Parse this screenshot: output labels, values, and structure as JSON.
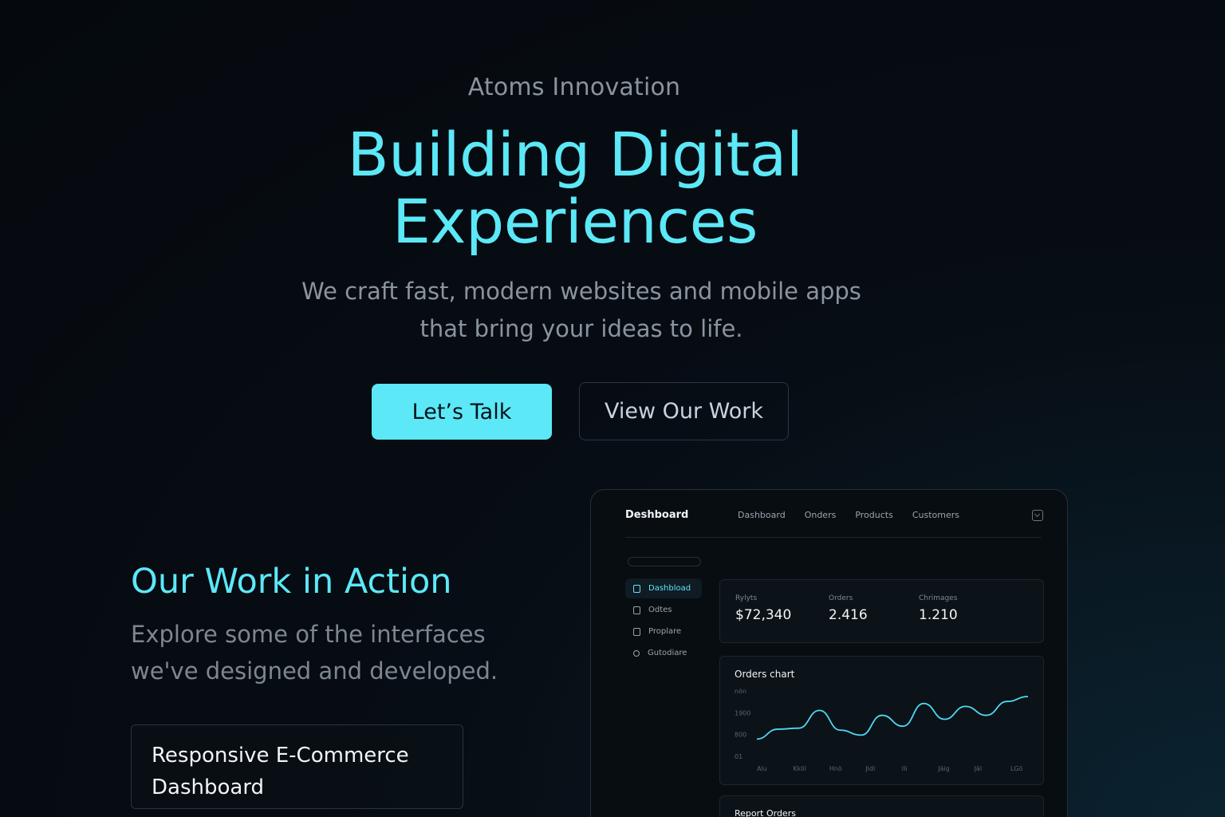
{
  "hero": {
    "brand": "Atoms Innovation",
    "title": "Building Digital Experiences",
    "subtitle_lines": [
      "We craft fast, modern websites and mobile apps",
      "that bring your ideas to life."
    ],
    "primary_cta": "Let’s Talk",
    "secondary_cta": "View Our Work"
  },
  "work": {
    "title": "Our Work in Action",
    "subtitle_lines": [
      "Explore some of the interfaces",
      "we've designed and developed."
    ],
    "project_lines": [
      "Responsive E-Commerce",
      "Dashboard"
    ]
  },
  "dashboard": {
    "brand": "Deshboard",
    "nav": [
      "Dashboard",
      "Onders",
      "Products",
      "Customers"
    ],
    "sidebar": [
      {
        "label": "Dashbload",
        "icon": "square-icon",
        "active": true
      },
      {
        "label": "Odtes",
        "icon": "clipboard-icon",
        "active": false
      },
      {
        "label": "Proplare",
        "icon": "box-icon",
        "active": false
      },
      {
        "label": "Gutodiare",
        "icon": "user-icon",
        "active": false
      }
    ],
    "stats": [
      {
        "label": "Rylyts",
        "value": "$72,340"
      },
      {
        "label": "Orders",
        "value": "2.416"
      },
      {
        "label": "Chrimages",
        "value": "1.210"
      }
    ],
    "report_title": "Report Orders"
  },
  "chart_data": {
    "type": "line",
    "title": "Orders chart",
    "y_tick_labels": [
      "nön",
      "1900",
      "800",
      "01"
    ],
    "x_tick_labels": [
      "Alu",
      "Kklil",
      "Hnö",
      "Jldl",
      "Ili",
      "Jäig",
      "Jäl",
      "LGö"
    ],
    "series": [
      {
        "values": [
          0.14,
          0.34,
          0.36,
          0.72,
          0.32,
          0.22,
          0.62,
          0.4,
          0.86,
          0.54,
          0.8,
          0.62,
          0.9,
          1.0
        ]
      }
    ],
    "color": "#4fd8f2"
  },
  "colors": {
    "accent": "#5ce8f7",
    "background": "#05090e",
    "muted_text": "#8a949e"
  }
}
